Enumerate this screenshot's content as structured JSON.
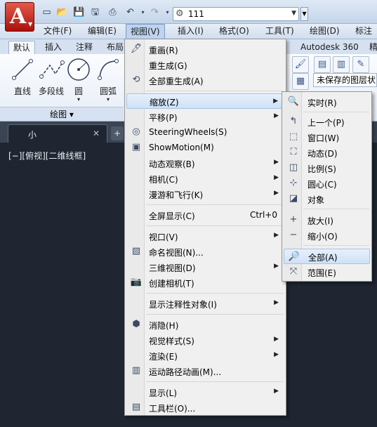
{
  "quick_access": {
    "workspace_value": "111"
  },
  "menubar": {
    "items": [
      {
        "label": "文件(F)"
      },
      {
        "label": "编辑(E)"
      },
      {
        "label": "视图(V)"
      },
      {
        "label": "插入(I)"
      },
      {
        "label": "格式(O)"
      },
      {
        "label": "工具(T)"
      },
      {
        "label": "绘图(D)"
      },
      {
        "label": "标注"
      }
    ]
  },
  "ribbon": {
    "tabs": [
      {
        "label": "默认"
      },
      {
        "label": "插入"
      },
      {
        "label": "注释"
      },
      {
        "label": "布局"
      },
      {
        "label": "Autodesk 360"
      },
      {
        "label": "精"
      }
    ],
    "draw_tools": [
      {
        "label": "直线"
      },
      {
        "label": "多段线"
      },
      {
        "label": "圆"
      },
      {
        "label": "圆弧"
      }
    ],
    "draw_panel_label": "绘图 ▾",
    "layer_state_text": "未保存的图层状"
  },
  "document": {
    "tab_label": "小",
    "viewport_label": "[−][俯视][二维线框]"
  },
  "view_menu": {
    "items": [
      {
        "label": "重画(R)",
        "icon": "redraw-icon"
      },
      {
        "label": "重生成(G)"
      },
      {
        "label": "全部重生成(A)",
        "icon": "regen-all-icon"
      },
      {
        "label": "缩放(Z)",
        "submenu": true,
        "highlighted": true
      },
      {
        "label": "平移(P)",
        "submenu": true
      },
      {
        "label": "SteeringWheels(S)",
        "icon": "steeringwheel-icon"
      },
      {
        "label": "ShowMotion(M)",
        "icon": "showmotion-icon"
      },
      {
        "label": "动态观察(B)",
        "submenu": true
      },
      {
        "label": "相机(C)",
        "submenu": true
      },
      {
        "label": "漫游和飞行(K)",
        "submenu": true
      },
      {
        "label": "全屏显示(C)",
        "shortcut": "Ctrl+0"
      },
      {
        "label": "视口(V)",
        "submenu": true
      },
      {
        "label": "命名视图(N)...",
        "icon": "named-view-icon"
      },
      {
        "label": "三维视图(D)",
        "submenu": true
      },
      {
        "label": "创建相机(T)",
        "icon": "camera-icon"
      },
      {
        "label": "显示注释性对象(I)",
        "submenu": true
      },
      {
        "label": "消隐(H)",
        "icon": "hide-icon"
      },
      {
        "label": "视觉样式(S)",
        "submenu": true
      },
      {
        "label": "渲染(E)",
        "submenu": true
      },
      {
        "label": "运动路径动画(M)...",
        "icon": "motion-path-icon"
      },
      {
        "label": "显示(L)",
        "submenu": true
      },
      {
        "label": "工具栏(O)...",
        "icon": "toolbar-icon"
      }
    ]
  },
  "zoom_menu": {
    "items": [
      {
        "label": "实时(R)",
        "icon": "zoom-realtime-icon"
      },
      {
        "label": "上一个(P)",
        "icon": "zoom-previous-icon"
      },
      {
        "label": "窗口(W)",
        "icon": "zoom-window-icon"
      },
      {
        "label": "动态(D)",
        "icon": "zoom-dynamic-icon"
      },
      {
        "label": "比例(S)",
        "icon": "zoom-scale-icon"
      },
      {
        "label": "圆心(C)",
        "icon": "zoom-center-icon"
      },
      {
        "label": "对象",
        "icon": "zoom-object-icon"
      },
      {
        "label": "放大(I)",
        "icon": "zoom-in-icon"
      },
      {
        "label": "缩小(O)",
        "icon": "zoom-out-icon"
      },
      {
        "label": "全部(A)",
        "icon": "zoom-all-icon",
        "highlighted": true
      },
      {
        "label": "范围(E)",
        "icon": "zoom-extents-icon"
      }
    ]
  },
  "colors": {
    "brand_red": "#c0271a",
    "menu_highlight": "#cfe1f7",
    "canvas": "#1f2631"
  }
}
